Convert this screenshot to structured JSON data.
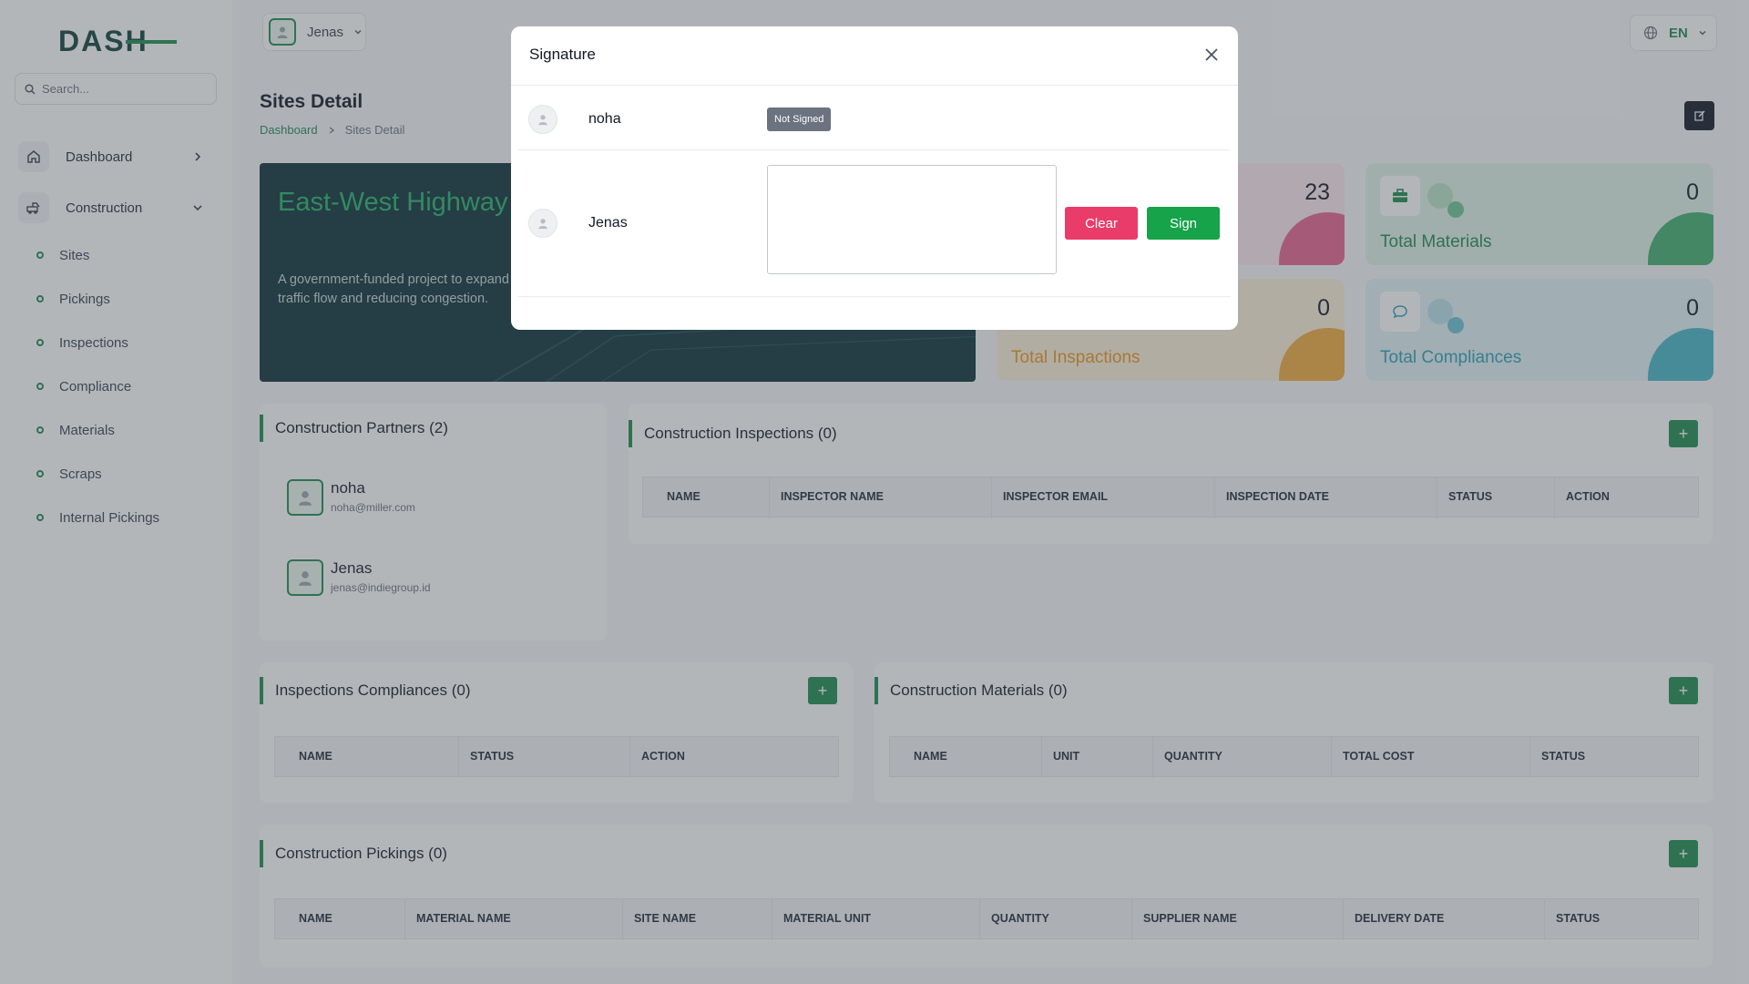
{
  "sidebar": {
    "logo_text": "DASH",
    "search_placeholder": "Search...",
    "items": [
      {
        "label": "Dashboard",
        "icon": "home-icon"
      },
      {
        "label": "Construction",
        "icon": "construction-icon"
      }
    ],
    "sub_items": [
      "Sites",
      "Pickings",
      "Inspections",
      "Compliance",
      "Materials",
      "Scraps",
      "Internal Pickings"
    ]
  },
  "topbar": {
    "user_name": "Jenas",
    "language": "EN"
  },
  "page": {
    "title": "Sites Detail",
    "breadcrumb": {
      "home": "Dashboard",
      "current": "Sites Detail"
    }
  },
  "hero": {
    "title": "East-West Highway Expansion",
    "description": "A government-funded project to expand the highway to six lanes, improving traffic flow and reducing congestion."
  },
  "stats": {
    "top_left_value": "23",
    "materials": {
      "label": "Total Materials",
      "value": "0"
    },
    "inspections": {
      "label": "Total Inspactions",
      "value": "0"
    },
    "compliances": {
      "label": "Total Compliances",
      "value": "0"
    }
  },
  "partners": {
    "title": "Construction Partners (2)",
    "list": [
      {
        "name": "noha",
        "email": "noha@miller.com"
      },
      {
        "name": "Jenas",
        "email": "jenas@indiegroup.id"
      }
    ]
  },
  "inspections_table": {
    "title": "Construction Inspections (0)",
    "columns": [
      "NAME",
      "INSPECTOR NAME",
      "INSPECTOR EMAIL",
      "INSPECTION DATE",
      "STATUS",
      "ACTION"
    ]
  },
  "compliances_table": {
    "title": "Inspections Compliances (0)",
    "columns": [
      "NAME",
      "STATUS",
      "ACTION"
    ]
  },
  "materials_table": {
    "title": "Construction Materials (0)",
    "columns": [
      "NAME",
      "UNIT",
      "QUANTITY",
      "TOTAL COST",
      "STATUS"
    ]
  },
  "pickings_table": {
    "title": "Construction Pickings (0)",
    "columns": [
      "NAME",
      "MATERIAL NAME",
      "SITE NAME",
      "MATERIAL UNIT",
      "QUANTITY",
      "SUPPLIER NAME",
      "DELIVERY DATE",
      "STATUS"
    ]
  },
  "modal": {
    "title": "Signature",
    "rows": [
      {
        "name": "noha",
        "status": "Not Signed"
      },
      {
        "name": "Jenas"
      }
    ],
    "clear_label": "Clear",
    "sign_label": "Sign"
  },
  "colors": {
    "brand_green": "#1d8a4e",
    "clear_button": "#ea3c6a",
    "sign_button": "#16a34a",
    "hero_bg": "#0c2f36"
  }
}
